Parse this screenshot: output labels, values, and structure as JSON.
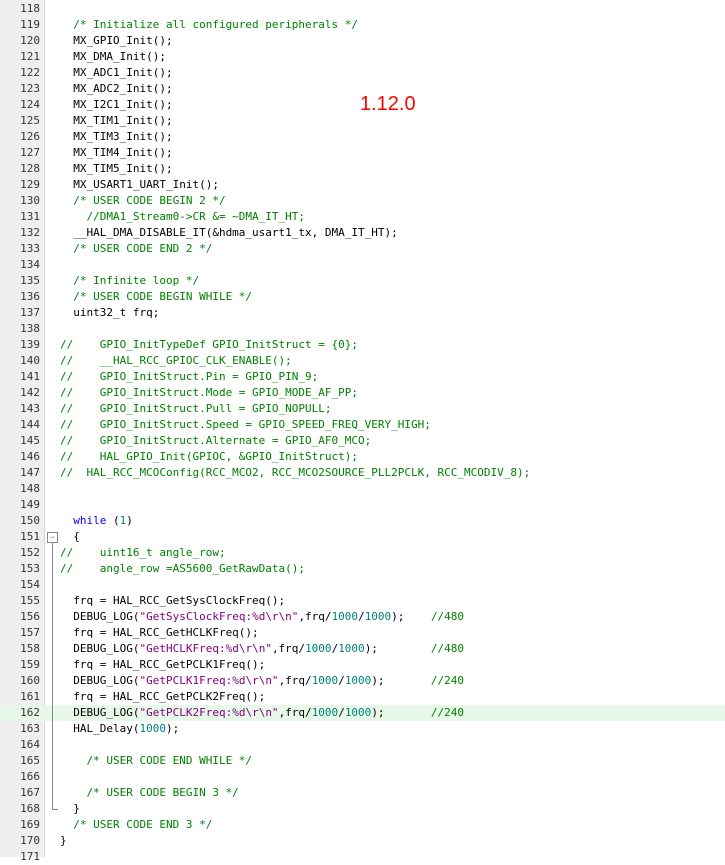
{
  "version_label": "1.12.0",
  "colors": {
    "comment": "#008000",
    "keyword": "#0000ff",
    "string": "#800080",
    "number": "#008080",
    "highlight": "#e8f8e8",
    "annotation": "#ff0000"
  },
  "lines": [
    {
      "n": "118",
      "t": []
    },
    {
      "n": "119",
      "t": [
        [
          "c",
          "  /* Initialize all configured peripherals */"
        ]
      ]
    },
    {
      "n": "120",
      "t": [
        [
          "p",
          "  MX_GPIO_Init();"
        ]
      ]
    },
    {
      "n": "121",
      "t": [
        [
          "p",
          "  MX_DMA_Init();"
        ]
      ]
    },
    {
      "n": "122",
      "t": [
        [
          "p",
          "  MX_ADC1_Init();"
        ]
      ]
    },
    {
      "n": "123",
      "t": [
        [
          "p",
          "  MX_ADC2_Init();"
        ]
      ]
    },
    {
      "n": "124",
      "t": [
        [
          "p",
          "  MX_I2C1_Init();"
        ]
      ]
    },
    {
      "n": "125",
      "t": [
        [
          "p",
          "  MX_TIM1_Init();"
        ]
      ]
    },
    {
      "n": "126",
      "t": [
        [
          "p",
          "  MX_TIM3_Init();"
        ]
      ]
    },
    {
      "n": "127",
      "t": [
        [
          "p",
          "  MX_TIM4_Init();"
        ]
      ]
    },
    {
      "n": "128",
      "t": [
        [
          "p",
          "  MX_TIM5_Init();"
        ]
      ]
    },
    {
      "n": "129",
      "t": [
        [
          "p",
          "  MX_USART1_UART_Init();"
        ]
      ]
    },
    {
      "n": "130",
      "t": [
        [
          "c",
          "  /* USER CODE BEGIN 2 */"
        ]
      ]
    },
    {
      "n": "131",
      "t": [
        [
          "c",
          "    //DMA1_Stream0->CR &= ~DMA_IT_HT;"
        ]
      ]
    },
    {
      "n": "132",
      "t": [
        [
          "p",
          "  __HAL_DMA_DISABLE_IT(&hdma_usart1_tx, DMA_IT_HT);"
        ]
      ]
    },
    {
      "n": "133",
      "t": [
        [
          "c",
          "  /* USER CODE END 2 */"
        ]
      ]
    },
    {
      "n": "134",
      "t": []
    },
    {
      "n": "135",
      "t": [
        [
          "c",
          "  /* Infinite loop */"
        ]
      ]
    },
    {
      "n": "136",
      "t": [
        [
          "c",
          "  /* USER CODE BEGIN WHILE */"
        ]
      ]
    },
    {
      "n": "137",
      "t": [
        [
          "p",
          "  uint32_t frq;"
        ]
      ]
    },
    {
      "n": "138",
      "t": []
    },
    {
      "n": "139",
      "t": [
        [
          "c",
          "//    GPIO_InitTypeDef GPIO_InitStruct = {0};"
        ]
      ]
    },
    {
      "n": "140",
      "t": [
        [
          "c",
          "//    __HAL_RCC_GPIOC_CLK_ENABLE();"
        ]
      ]
    },
    {
      "n": "141",
      "t": [
        [
          "c",
          "//    GPIO_InitStruct.Pin = GPIO_PIN_9;"
        ]
      ]
    },
    {
      "n": "142",
      "t": [
        [
          "c",
          "//    GPIO_InitStruct.Mode = GPIO_MODE_AF_PP;"
        ]
      ]
    },
    {
      "n": "143",
      "t": [
        [
          "c",
          "//    GPIO_InitStruct.Pull = GPIO_NOPULL;"
        ]
      ]
    },
    {
      "n": "144",
      "t": [
        [
          "c",
          "//    GPIO_InitStruct.Speed = GPIO_SPEED_FREQ_VERY_HIGH;"
        ]
      ]
    },
    {
      "n": "145",
      "t": [
        [
          "c",
          "//    GPIO_InitStruct.Alternate = GPIO_AF0_MCO;"
        ]
      ]
    },
    {
      "n": "146",
      "t": [
        [
          "c",
          "//    HAL_GPIO_Init(GPIOC, &GPIO_InitStruct);"
        ]
      ]
    },
    {
      "n": "147",
      "t": [
        [
          "c",
          "//  HAL_RCC_MCOConfig(RCC_MCO2, RCC_MCO2SOURCE_PLL2PCLK, RCC_MCODIV_8);"
        ]
      ]
    },
    {
      "n": "148",
      "t": []
    },
    {
      "n": "149",
      "t": []
    },
    {
      "n": "150",
      "t": [
        [
          "k",
          "  while"
        ],
        [
          "p",
          " ("
        ],
        [
          "num",
          "1"
        ],
        [
          "p",
          ")"
        ]
      ]
    },
    {
      "n": "151",
      "t": [
        [
          "p",
          "  {"
        ]
      ]
    },
    {
      "n": "152",
      "t": [
        [
          "c",
          "//    uint16_t angle_row;"
        ]
      ]
    },
    {
      "n": "153",
      "t": [
        [
          "c",
          "//    angle_row =AS5600_GetRawData();"
        ]
      ]
    },
    {
      "n": "154",
      "t": []
    },
    {
      "n": "155",
      "t": [
        [
          "p",
          "  frq = HAL_RCC_GetSysClockFreq();"
        ]
      ]
    },
    {
      "n": "156",
      "t": [
        [
          "p",
          "  DEBUG_LOG("
        ],
        [
          "s",
          "\"GetSysClockFreq:%d\\r\\n\""
        ],
        [
          "p",
          ",frq/"
        ],
        [
          "num",
          "1000"
        ],
        [
          "p",
          "/"
        ],
        [
          "num",
          "1000"
        ],
        [
          "p",
          ");    "
        ],
        [
          "c",
          "//480"
        ]
      ]
    },
    {
      "n": "157",
      "t": [
        [
          "p",
          "  frq = HAL_RCC_GetHCLKFreq();"
        ]
      ]
    },
    {
      "n": "158",
      "t": [
        [
          "p",
          "  DEBUG_LOG("
        ],
        [
          "s",
          "\"GetHCLKFreq:%d\\r\\n\""
        ],
        [
          "p",
          ",frq/"
        ],
        [
          "num",
          "1000"
        ],
        [
          "p",
          "/"
        ],
        [
          "num",
          "1000"
        ],
        [
          "p",
          ");        "
        ],
        [
          "c",
          "//480"
        ]
      ]
    },
    {
      "n": "159",
      "t": [
        [
          "p",
          "  frq = HAL_RCC_GetPCLK1Freq();"
        ]
      ]
    },
    {
      "n": "160",
      "t": [
        [
          "p",
          "  DEBUG_LOG("
        ],
        [
          "s",
          "\"GetPCLK1Freq:%d\\r\\n\""
        ],
        [
          "p",
          ",frq/"
        ],
        [
          "num",
          "1000"
        ],
        [
          "p",
          "/"
        ],
        [
          "num",
          "1000"
        ],
        [
          "p",
          ");       "
        ],
        [
          "c",
          "//240"
        ]
      ]
    },
    {
      "n": "161",
      "t": [
        [
          "p",
          "  frq = HAL_RCC_GetPCLK2Freq();"
        ]
      ]
    },
    {
      "n": "162",
      "t": [
        [
          "p",
          "  DEBUG_LOG("
        ],
        [
          "s",
          "\"GetPCLK2Freq:%d\\r\\n\""
        ],
        [
          "p",
          ",frq/"
        ],
        [
          "num",
          "1000"
        ],
        [
          "p",
          "/"
        ],
        [
          "num",
          "1000"
        ],
        [
          "p",
          ");       "
        ],
        [
          "c",
          "//240"
        ]
      ],
      "hl": true
    },
    {
      "n": "163",
      "t": [
        [
          "p",
          "  HAL_Delay("
        ],
        [
          "num",
          "1000"
        ],
        [
          "p",
          ");"
        ]
      ]
    },
    {
      "n": "164",
      "t": []
    },
    {
      "n": "165",
      "t": [
        [
          "c",
          "    /* USER CODE END WHILE */"
        ]
      ]
    },
    {
      "n": "166",
      "t": []
    },
    {
      "n": "167",
      "t": [
        [
          "c",
          "    /* USER CODE BEGIN 3 */"
        ]
      ]
    },
    {
      "n": "168",
      "t": [
        [
          "p",
          "  }"
        ]
      ]
    },
    {
      "n": "169",
      "t": [
        [
          "c",
          "  /* USER CODE END 3 */"
        ]
      ]
    },
    {
      "n": "170",
      "t": [
        [
          "p",
          "}"
        ]
      ]
    },
    {
      "n": "171",
      "t": []
    }
  ]
}
